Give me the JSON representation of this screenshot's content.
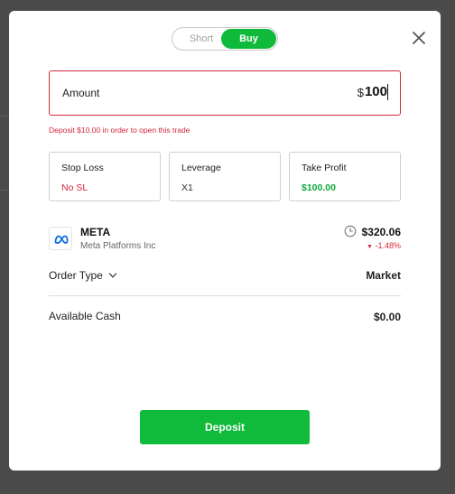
{
  "toggle": {
    "short_label": "Short",
    "buy_label": "Buy",
    "selected": "Buy"
  },
  "amount": {
    "label": "Amount",
    "currency": "$",
    "value": "100"
  },
  "error": "Deposit $10.00 in order to open this trade",
  "stop_loss": {
    "label": "Stop Loss",
    "value": "No SL"
  },
  "leverage": {
    "label": "Leverage",
    "value": "X1"
  },
  "take_profit": {
    "label": "Take Profit",
    "value": "$100.00"
  },
  "asset": {
    "symbol": "META",
    "name": "Meta Platforms Inc",
    "price": "$320.06",
    "change": "-1.48%",
    "logo_icon": "meta-logo-icon"
  },
  "order_type": {
    "label": "Order Type",
    "value": "Market"
  },
  "available_cash": {
    "label": "Available Cash",
    "value": "$0.00"
  },
  "deposit_button": "Deposit",
  "colors": {
    "accent_green": "#0fba3a",
    "error_red": "#d2283a",
    "meta_blue": "#0668e1"
  }
}
